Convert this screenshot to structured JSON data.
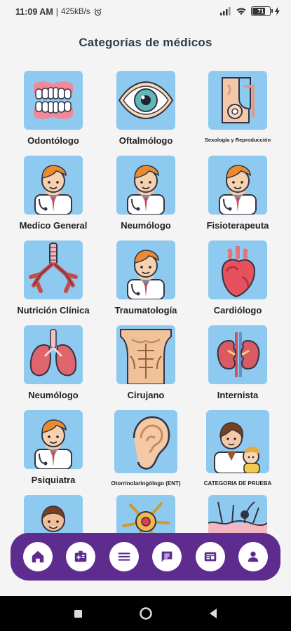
{
  "status": {
    "time": "11:09 AM",
    "rate": "425kB/s",
    "battery": "71"
  },
  "page_title": "Categorías de médicos",
  "categories": [
    {
      "label": "Odontólogo",
      "icon": "teeth-icon"
    },
    {
      "label": "Oftalmólogo",
      "icon": "eye-icon"
    },
    {
      "label": "Sexología y Reproducción",
      "icon": "reproductive-icon"
    },
    {
      "label": "Medico General",
      "icon": "doctor-icon"
    },
    {
      "label": "Neumólogo",
      "icon": "doctor-icon"
    },
    {
      "label": "Fisioterapeuta",
      "icon": "doctor-icon"
    },
    {
      "label": "Nutrición Clínica",
      "icon": "bronchi-icon"
    },
    {
      "label": "Traumatología",
      "icon": "doctor-icon"
    },
    {
      "label": "Cardiólogo",
      "icon": "heart-icon"
    },
    {
      "label": "Neumólogo",
      "icon": "lungs-icon"
    },
    {
      "label": "Cirujano",
      "icon": "torso-icon"
    },
    {
      "label": "Internista",
      "icon": "kidneys-icon"
    },
    {
      "label": "Psiquiatra",
      "icon": "doctor-icon"
    },
    {
      "label": "Otorrinolaringólogo (ENT)",
      "icon": "ear-icon"
    },
    {
      "label": "CATEGORIA DE PRUEBA",
      "icon": "pediatrician-icon"
    }
  ],
  "nav": [
    "home-icon",
    "medical-card-icon",
    "menu-icon",
    "chat-icon",
    "news-icon",
    "profile-icon"
  ],
  "colors": {
    "accent": "#5e2c8f",
    "tile": "#8ec9ef",
    "title": "#2f3e4d"
  }
}
